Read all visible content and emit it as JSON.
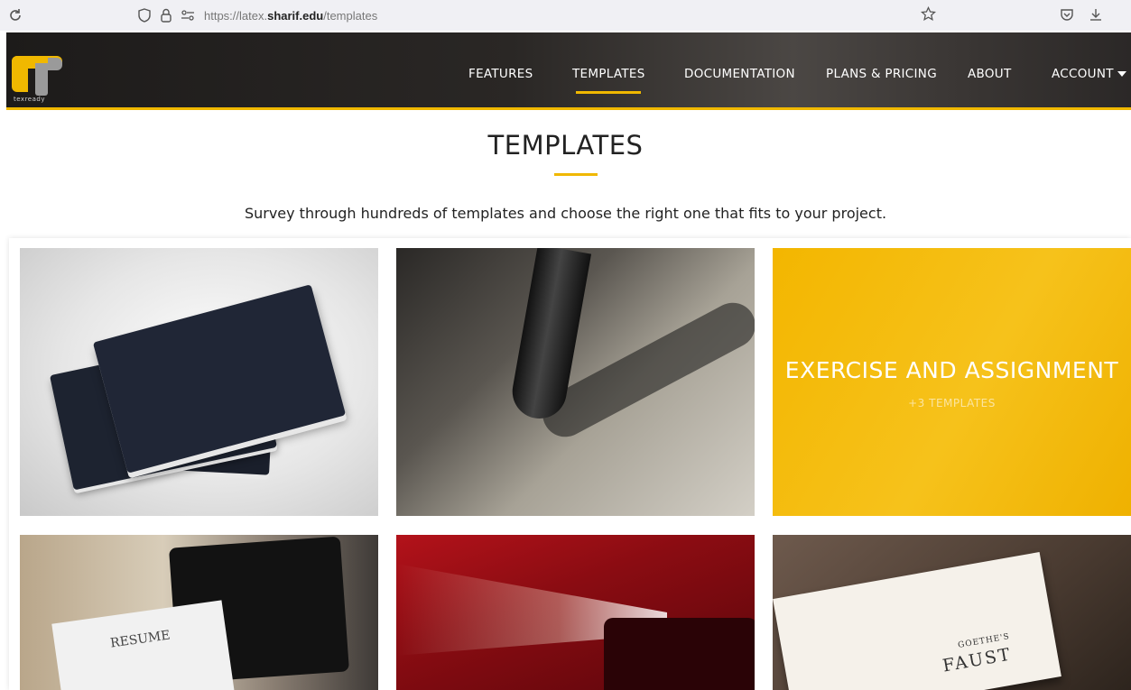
{
  "browser": {
    "url_prefix": "https://latex.",
    "url_domain": "sharif.edu",
    "url_path": "/templates"
  },
  "header": {
    "logo_tag": "texready",
    "nav": [
      {
        "label": "FEATURES"
      },
      {
        "label": "TEMPLATES",
        "active": true
      },
      {
        "label": "DOCUMENTATION"
      },
      {
        "label": "PLANS & PRICING"
      },
      {
        "label": "ABOUT"
      },
      {
        "label": "ACCOUNT"
      }
    ]
  },
  "page": {
    "title": "TEMPLATES",
    "subtitle": "Survey through hundreds of templates and choose the right one that fits to your project."
  },
  "cards": {
    "exercise_title": "EXERCISE AND ASSIGNMENT",
    "exercise_sub": "+3 TEMPLATES",
    "resume_text": "RESUME",
    "book_small": "GOETHE'S",
    "book_big": "FAUST"
  },
  "colors": {
    "accent": "#f0b800",
    "header_bg": "#2a2725"
  },
  "icons": {
    "reload": "reload-icon",
    "shield": "shield-icon",
    "lock": "lock-icon",
    "permissions": "permissions-icon",
    "star": "bookmark-star-icon",
    "pocket": "pocket-icon",
    "download": "download-icon"
  }
}
